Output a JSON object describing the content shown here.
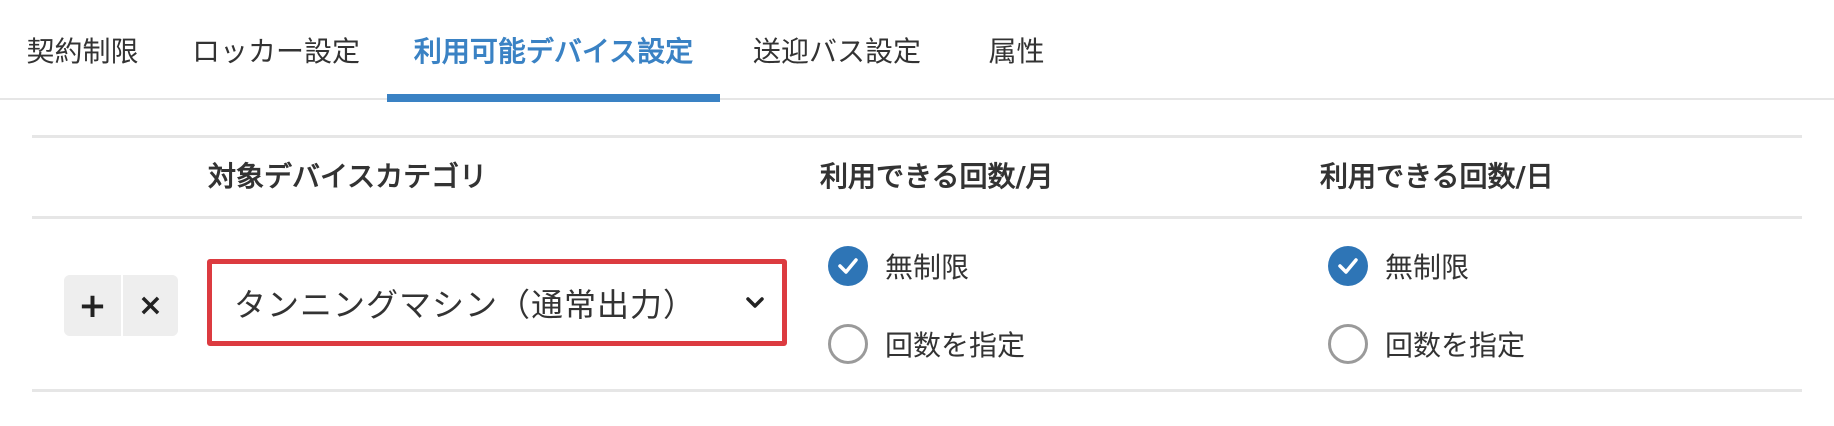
{
  "tabs": [
    {
      "label": "契約制限",
      "active": false
    },
    {
      "label": "ロッカー設定",
      "active": false
    },
    {
      "label": "利用可能デバイス設定",
      "active": true
    },
    {
      "label": "送迎バス設定",
      "active": false
    },
    {
      "label": "属性",
      "active": false
    }
  ],
  "table": {
    "headers": {
      "category": "対象デバイスカテゴリ",
      "per_month": "利用できる回数/月",
      "per_day": "利用できる回数/日"
    },
    "rows": [
      {
        "actions": {
          "add_glyph": "+",
          "remove_glyph": "×"
        },
        "category_select": {
          "value": "タンニングマシン（通常出力）",
          "icon": "chevron-down-icon",
          "highlighted": true
        },
        "per_month": {
          "options": [
            {
              "label": "無制限",
              "checked": true
            },
            {
              "label": "回数を指定",
              "checked": false
            }
          ]
        },
        "per_day": {
          "options": [
            {
              "label": "無制限",
              "checked": true
            },
            {
              "label": "回数を指定",
              "checked": false
            }
          ]
        }
      }
    ]
  },
  "colors": {
    "accent": "#3a82c4",
    "radio_checked": "#2e75b6",
    "highlight_border": "#dc3b40"
  }
}
